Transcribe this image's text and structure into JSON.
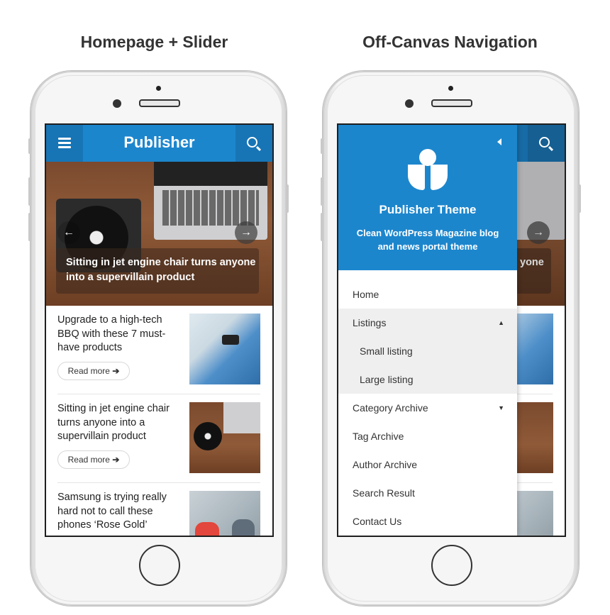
{
  "captions": {
    "left": "Homepage + Slider",
    "right": "Off-Canvas Navigation"
  },
  "colors": {
    "brand": "#1c86cd",
    "brand_dark": "#1775b6"
  },
  "left_phone": {
    "header": {
      "brand": "Publisher",
      "menu_icon": "hamburger-icon",
      "search_icon": "search-icon"
    },
    "slider": {
      "title": "Sitting in jet engine chair turns anyone into a supervillain product",
      "prev_icon": "arrow-left-icon",
      "next_icon": "arrow-right-icon"
    },
    "posts": [
      {
        "title": "Upgrade to a high-tech BBQ with these 7 must-have products",
        "read_more": "Read more"
      },
      {
        "title": "Sitting in jet engine chair turns anyone into a supervillain product",
        "read_more": "Read more"
      },
      {
        "title": "Samsung is trying really hard not to call these phones ‘Rose Gold’"
      }
    ]
  },
  "right_phone": {
    "drawer": {
      "title": "Publisher Theme",
      "tagline": "Clean WordPress Magazine blog and news portal theme",
      "close_icon": "caret-left-icon",
      "logo_icon": "publisher-logo-icon",
      "menu": [
        {
          "label": "Home"
        },
        {
          "label": "Listings",
          "expanded": true
        },
        {
          "label": "Small listing",
          "sub": true
        },
        {
          "label": "Large listing",
          "sub": true
        },
        {
          "label": "Category Archive",
          "has_children": true
        },
        {
          "label": "Tag Archive"
        },
        {
          "label": "Author Archive"
        },
        {
          "label": "Search Result"
        },
        {
          "label": "Contact Us"
        }
      ]
    },
    "behind": {
      "slide_fragment": "yone"
    }
  }
}
